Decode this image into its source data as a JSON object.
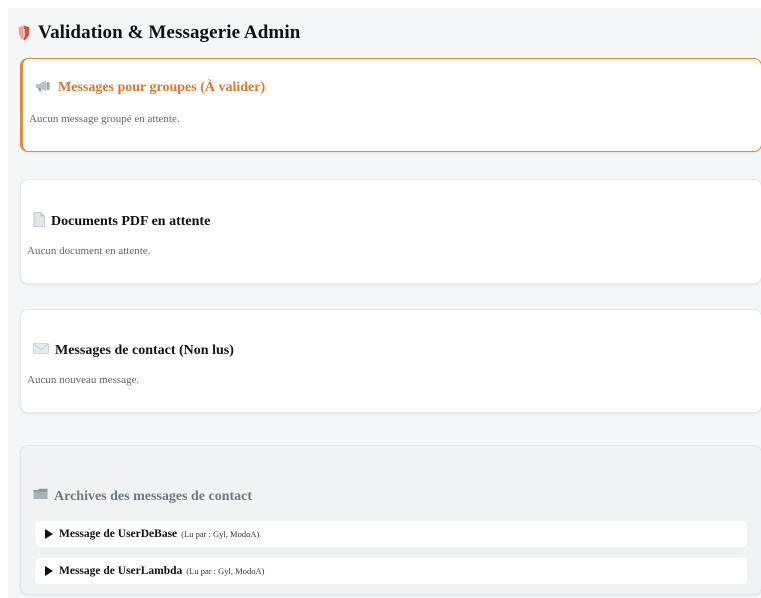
{
  "header": {
    "title": "Validation & Messagerie Admin",
    "icon": "shield-icon"
  },
  "pending_groups": {
    "icon": "megaphone-icon",
    "title": "Messages pour groupes (À valider)",
    "empty_text": "Aucun message groupé en attente.",
    "accent": "#e3893a"
  },
  "pdf_documents": {
    "icon": "document-icon",
    "title": "Documents PDF en attente",
    "empty_text": "Aucun document en attente."
  },
  "contact_messages": {
    "icon": "envelope-icon",
    "title": "Messages de contact (Non lus)",
    "empty_text": "Aucun nouveau message."
  },
  "archives": {
    "icon": "folder-icon",
    "title": "Archives des messages de contact",
    "items": [
      {
        "title": "Message de UserDeBase",
        "meta": "(Lu par : Gyl, ModoA)"
      },
      {
        "title": "Message de UserLambda",
        "meta": "(Lu par : Gyl, ModoA)"
      }
    ]
  }
}
